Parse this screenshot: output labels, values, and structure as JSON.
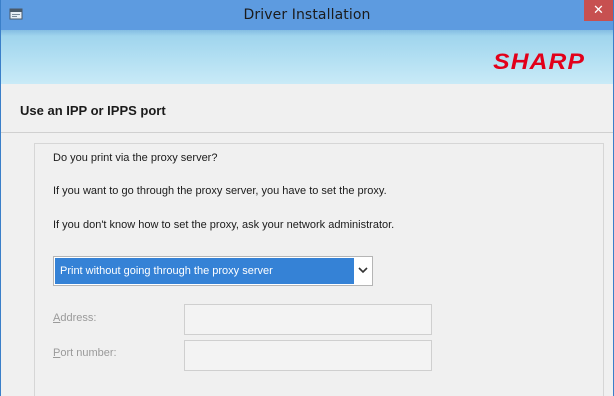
{
  "window": {
    "title": "Driver Installation",
    "close_label": "✕",
    "app_icon": "installer-app-icon"
  },
  "banner": {
    "brand": "SHARP",
    "brand_color": "#e2001a"
  },
  "page": {
    "heading": "Use an IPP or IPPS port",
    "question": "Do you print via the proxy server?",
    "info1": "If you want to go through the proxy server, you have to set the proxy.",
    "info2": "If you don't know how to set the proxy, ask your network administrator."
  },
  "proxy_select": {
    "selected": "Print without going through the proxy server",
    "arrow_icon": "chevron-down-icon",
    "highlight_color": "#3582d6"
  },
  "fields": {
    "address": {
      "label_first": "A",
      "label_rest": "ddress:",
      "value": ""
    },
    "port": {
      "label_first": "P",
      "label_rest": "ort number:",
      "value": ""
    }
  }
}
